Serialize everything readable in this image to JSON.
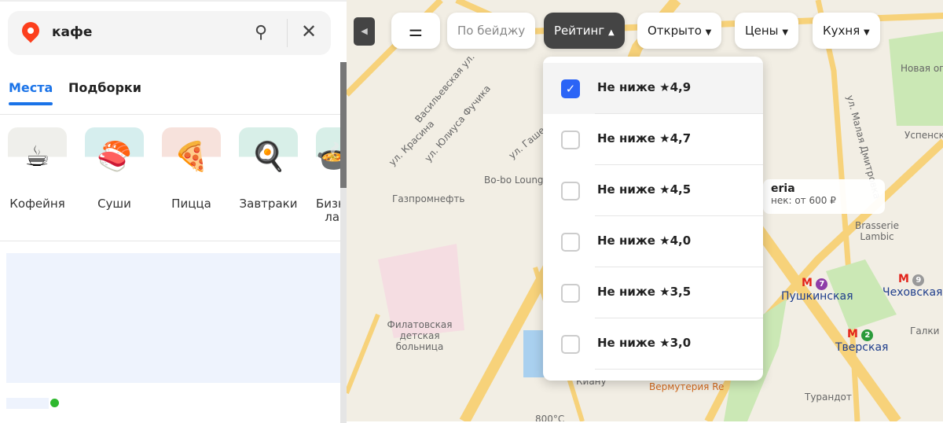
{
  "search": {
    "query": "кафе"
  },
  "tabs": [
    {
      "label": "Места",
      "active": true
    },
    {
      "label": "Подборки",
      "active": false
    }
  ],
  "categories": [
    {
      "label": "Кофейня",
      "icon": "☕"
    },
    {
      "label": "Суши",
      "icon": "🍣"
    },
    {
      "label": "Пицца",
      "icon": "🍕"
    },
    {
      "label": "Завтраки",
      "icon": "🍳"
    },
    {
      "label": "Бизнес-ланч",
      "icon": "🍲"
    }
  ],
  "filters": {
    "badge": "По бейджу",
    "rating": "Рейтинг",
    "open": "Открыто",
    "prices": "Цены",
    "cuisine": "Кухня"
  },
  "rating_options": [
    {
      "label": "Не ниже ★4,9",
      "checked": true
    },
    {
      "label": "Не ниже ★4,7",
      "checked": false
    },
    {
      "label": "Не ниже ★4,5",
      "checked": false
    },
    {
      "label": "Не ниже ★4,0",
      "checked": false
    },
    {
      "label": "Не ниже ★3,5",
      "checked": false
    },
    {
      "label": "Не ниже ★3,0",
      "checked": false
    }
  ],
  "card": {
    "title": "eria",
    "subtitle": "нек: от 600 ₽"
  },
  "map_labels": {
    "vasilevskaya": "Васильевская ул.",
    "fuchika": "ул. Юлиуса Фучика",
    "krasina": "ул. Красина",
    "gasheka": "ул. Гашека",
    "gazprom": "Газпромнефть",
    "bobo": "Bo-bo Lounge",
    "hospital": "Филатовская детская больница",
    "brasserie": "Brasserie Lambic",
    "galki": "Галки",
    "turandot": "Турандот",
    "vermuteria": "Вермутерия Re",
    "malaya_dmitrovka": "ул. Малая Дмитровка",
    "novaya": "Новая оп",
    "uspensky": "Успенский п",
    "kiano": "Киану",
    "temp": "800°С"
  },
  "metro": [
    {
      "name": "Пушкинская",
      "line": "7",
      "color": "#8e3da8"
    },
    {
      "name": "Чеховская",
      "line": "9",
      "color": "#999999"
    },
    {
      "name": "Тверская",
      "line": "2",
      "color": "#2a9a3a"
    }
  ]
}
